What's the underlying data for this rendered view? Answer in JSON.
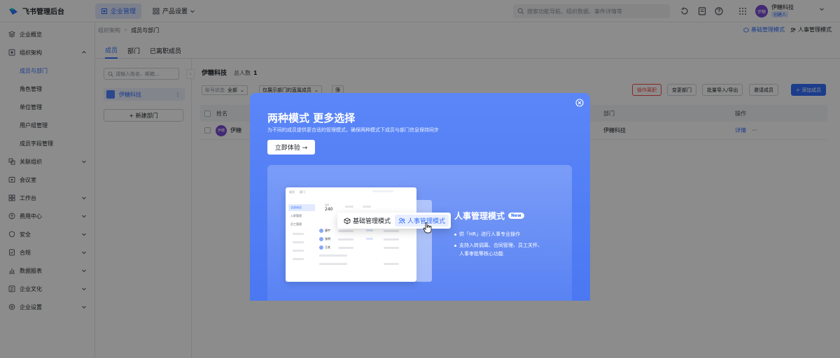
{
  "app": {
    "logo_text": "飞书管理后台",
    "nav_tabs": [
      {
        "label": "企业管理",
        "icon": "building-icon",
        "active": true
      },
      {
        "label": "产品设置",
        "icon": "apps-icon",
        "active": false
      }
    ],
    "search_placeholder": "搜索功能导航、组织数据、事件详情等",
    "org_name": "伊糖科技",
    "org_badge": "创建人",
    "avatar_text": "伊糖"
  },
  "sidebar": {
    "items": [
      {
        "label": "企业概览",
        "icon": "layers-icon"
      },
      {
        "label": "组织架构",
        "icon": "org-icon",
        "expanded": true,
        "children": [
          "成员与部门",
          "角色管理",
          "单位管理",
          "用户组管理",
          "成员字段管理"
        ]
      },
      {
        "label": "关联组织",
        "icon": "link-icon"
      },
      {
        "label": "会议室",
        "icon": "meeting-icon"
      },
      {
        "label": "工作台",
        "icon": "grid-icon"
      },
      {
        "label": "费用中心",
        "icon": "wallet-icon"
      },
      {
        "label": "安全",
        "icon": "shield-icon"
      },
      {
        "label": "合规",
        "icon": "compliance-icon"
      },
      {
        "label": "数据报表",
        "icon": "chart-icon"
      },
      {
        "label": "企业文化",
        "icon": "culture-icon"
      },
      {
        "label": "企业设置",
        "icon": "settings-icon"
      }
    ],
    "active_child": "成员与部门"
  },
  "main": {
    "breadcrumb": [
      "组织架构",
      "成员与部门"
    ],
    "mode_basic": "基础管理模式",
    "mode_hr": "人事管理模式",
    "subtabs": [
      "成员",
      "部门",
      "已离职成员"
    ],
    "member_search_placeholder": "请输入姓名、邮箱...",
    "dept_node": "伊糖科技",
    "new_dept": "+ 新建部门",
    "company_title": "伊糖科技",
    "total_label": "总人数",
    "total_value": "1",
    "filters": {
      "status_label": "账号状态",
      "status_value": "全部",
      "scope_value": "仅展示部门的直属成员",
      "extra": "筛"
    },
    "actions": {
      "record": "操作离职",
      "change_dept": "变更部门",
      "import_export": "批量导入/导出",
      "invite": "邀请成员",
      "add": "+ 添加成员"
    },
    "table": {
      "headers": {
        "name": "姓名",
        "dept": "部门",
        "ops": "操作"
      },
      "rows": [
        {
          "avatar": "伊糖",
          "name": "伊糖",
          "dept": "伊糖科技",
          "action": "详情",
          "more": "···"
        }
      ]
    }
  },
  "modal": {
    "title": "两种模式 更多选择",
    "subtitle": "为不同的成员提供更合适的管理模式，确保两种模式下成员与部门信息保持同步",
    "cta": "立即体验 →",
    "switcher": {
      "basic": "基础管理模式",
      "hr": "人事管理模式"
    },
    "hr_title": "人事管理模式",
    "new_badge": "New",
    "features": [
      "供「HR」进行人事专业操作",
      "支持入转调离、合同管理、员工关怀、",
      "人事审批等核心功能"
    ],
    "mock": {
      "tabs": [
        "成员",
        "部门"
      ],
      "side_items": [
        "全部成员",
        "入职管理",
        "员工管理"
      ],
      "stat_label": "全员",
      "stat_value": "240",
      "rows": [
        "唐宇",
        "张明",
        "王欢"
      ]
    }
  },
  "colors": {
    "accent": "#3370ff",
    "modal_bg": "#5b86f8",
    "danger": "#f54a45"
  }
}
